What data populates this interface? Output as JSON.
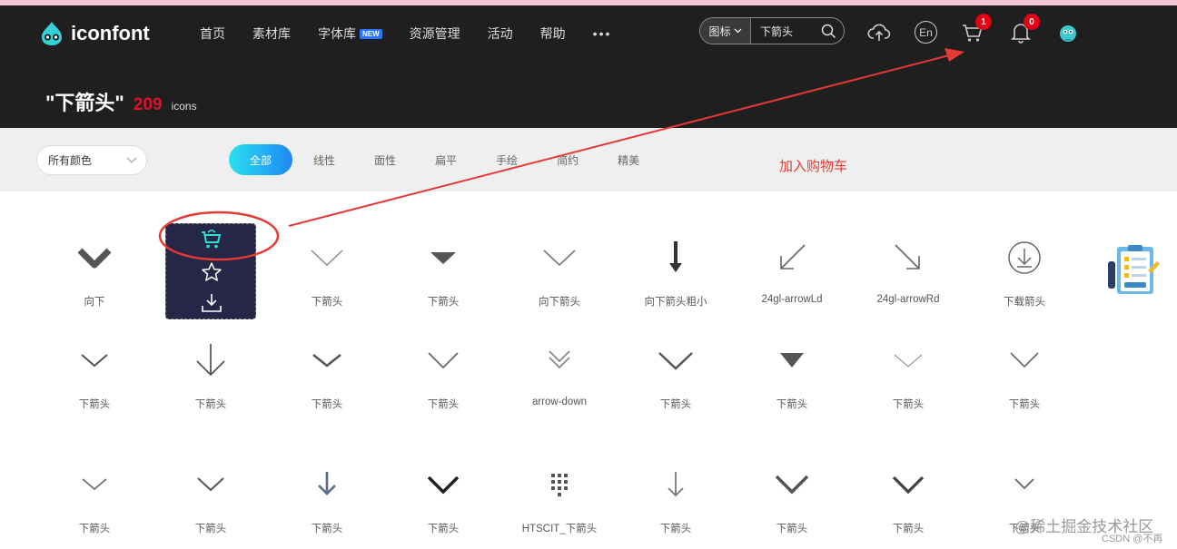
{
  "header": {
    "logo_text": "iconfont",
    "nav": [
      {
        "label": "首页"
      },
      {
        "label": "素材库"
      },
      {
        "label": "字体库",
        "badge": "NEW"
      },
      {
        "label": "资源管理"
      },
      {
        "label": "活动"
      },
      {
        "label": "帮助"
      }
    ],
    "more_label": "•••",
    "search": {
      "type_label": "图标",
      "query": "下箭头"
    },
    "cart_count": "1",
    "notification_count": "0",
    "lang_label": "En"
  },
  "heading": {
    "query_title": "\"下箭头\"",
    "count": "209",
    "unit": "icons"
  },
  "filters": {
    "color_select": "所有颜色",
    "tabs": [
      "全部",
      "线性",
      "面性",
      "扁平",
      "手绘",
      "简约",
      "精美"
    ],
    "active_tab": "全部"
  },
  "annotation": {
    "label": "加入购物车"
  },
  "icons": {
    "rows": [
      [
        "向下",
        "",
        "下箭头",
        "下箭头",
        "向下箭头",
        "向下箭头粗小",
        "24gl-arrowLd",
        "24gl-arrowRd",
        "下载箭头"
      ],
      [
        "下箭头",
        "下箭头",
        "下箭头",
        "下箭头",
        "arrow-down",
        "下箭头",
        "下箭头",
        "下箭头",
        "下箭头"
      ],
      [
        "下箭头",
        "下箭头",
        "下箭头",
        "下箭头",
        "HTSCIT_下箭头",
        "下箭头",
        "下箭头",
        "下箭头",
        "下箭头"
      ]
    ]
  },
  "watermark": {
    "text": "@稀土掘金技术社区",
    "source": "CSDN @不再"
  },
  "colors": {
    "topbar": "#1f1f1f",
    "accent_red": "#e0102a",
    "annotation_red": "#e53935",
    "tab_gradient_start": "#2ae0ee",
    "tab_gradient_end": "#1d88f4"
  }
}
